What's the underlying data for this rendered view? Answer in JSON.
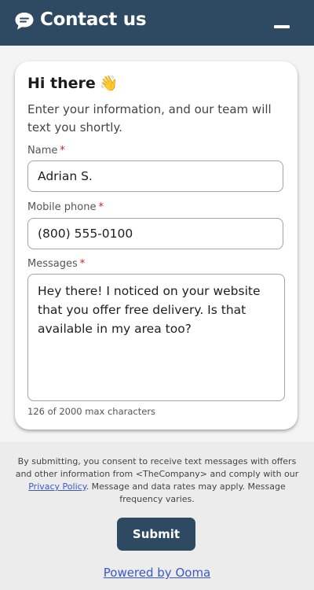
{
  "header": {
    "title": "Contact us",
    "icon": "chat-bubble-icon",
    "minimize_icon": "minimize-icon",
    "background": "#2d4a62"
  },
  "card": {
    "greeting": "Hi there",
    "greeting_emoji": "👋",
    "intro": "Enter your information, and our team will text you shortly."
  },
  "form": {
    "name_label": "Name",
    "name_value": "Adrian S.",
    "phone_label": "Mobile phone",
    "phone_value": "(800) 555-0100",
    "message_label": "Messages",
    "message_value": "Hey there! I noticed on your website that you offer free delivery. Is that available in my area too?",
    "required_marker": "*",
    "counter": "126 of 2000 max characters"
  },
  "footer": {
    "consent_before": "By submitting, you consent to receive text messages with offers and other information from <TheCompany> and comply with our ",
    "privacy_link": "Privacy Policy",
    "consent_after": ". Message and data rates may apply. Message frequency varies.",
    "submit_label": "Submit",
    "powered_by": "Powered by Ooma",
    "link_color": "#3a58c9"
  }
}
